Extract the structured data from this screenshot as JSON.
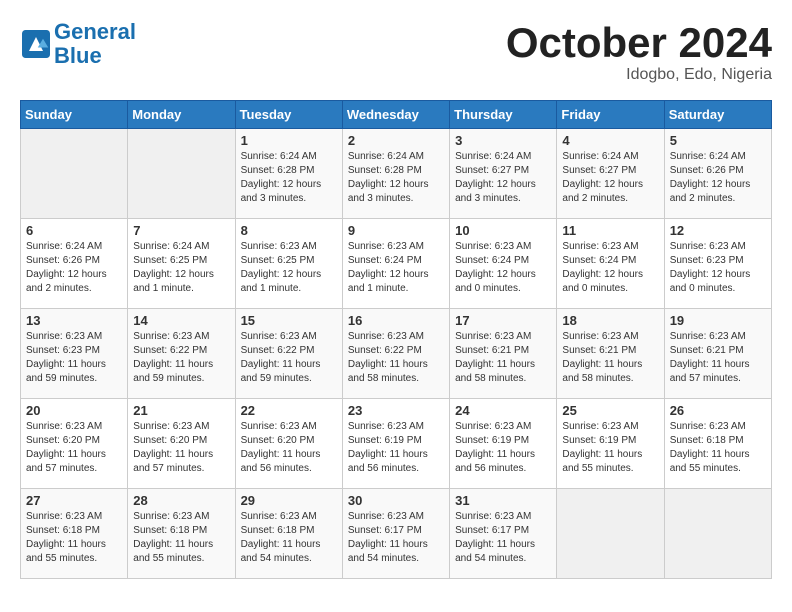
{
  "header": {
    "logo_line1": "General",
    "logo_line2": "Blue",
    "month": "October 2024",
    "location": "Idogbo, Edo, Nigeria"
  },
  "weekdays": [
    "Sunday",
    "Monday",
    "Tuesday",
    "Wednesday",
    "Thursday",
    "Friday",
    "Saturday"
  ],
  "weeks": [
    [
      {
        "day": "",
        "info": ""
      },
      {
        "day": "",
        "info": ""
      },
      {
        "day": "1",
        "info": "Sunrise: 6:24 AM\nSunset: 6:28 PM\nDaylight: 12 hours\nand 3 minutes."
      },
      {
        "day": "2",
        "info": "Sunrise: 6:24 AM\nSunset: 6:28 PM\nDaylight: 12 hours\nand 3 minutes."
      },
      {
        "day": "3",
        "info": "Sunrise: 6:24 AM\nSunset: 6:27 PM\nDaylight: 12 hours\nand 3 minutes."
      },
      {
        "day": "4",
        "info": "Sunrise: 6:24 AM\nSunset: 6:27 PM\nDaylight: 12 hours\nand 2 minutes."
      },
      {
        "day": "5",
        "info": "Sunrise: 6:24 AM\nSunset: 6:26 PM\nDaylight: 12 hours\nand 2 minutes."
      }
    ],
    [
      {
        "day": "6",
        "info": "Sunrise: 6:24 AM\nSunset: 6:26 PM\nDaylight: 12 hours\nand 2 minutes."
      },
      {
        "day": "7",
        "info": "Sunrise: 6:24 AM\nSunset: 6:25 PM\nDaylight: 12 hours\nand 1 minute."
      },
      {
        "day": "8",
        "info": "Sunrise: 6:23 AM\nSunset: 6:25 PM\nDaylight: 12 hours\nand 1 minute."
      },
      {
        "day": "9",
        "info": "Sunrise: 6:23 AM\nSunset: 6:24 PM\nDaylight: 12 hours\nand 1 minute."
      },
      {
        "day": "10",
        "info": "Sunrise: 6:23 AM\nSunset: 6:24 PM\nDaylight: 12 hours\nand 0 minutes."
      },
      {
        "day": "11",
        "info": "Sunrise: 6:23 AM\nSunset: 6:24 PM\nDaylight: 12 hours\nand 0 minutes."
      },
      {
        "day": "12",
        "info": "Sunrise: 6:23 AM\nSunset: 6:23 PM\nDaylight: 12 hours\nand 0 minutes."
      }
    ],
    [
      {
        "day": "13",
        "info": "Sunrise: 6:23 AM\nSunset: 6:23 PM\nDaylight: 11 hours\nand 59 minutes."
      },
      {
        "day": "14",
        "info": "Sunrise: 6:23 AM\nSunset: 6:22 PM\nDaylight: 11 hours\nand 59 minutes."
      },
      {
        "day": "15",
        "info": "Sunrise: 6:23 AM\nSunset: 6:22 PM\nDaylight: 11 hours\nand 59 minutes."
      },
      {
        "day": "16",
        "info": "Sunrise: 6:23 AM\nSunset: 6:22 PM\nDaylight: 11 hours\nand 58 minutes."
      },
      {
        "day": "17",
        "info": "Sunrise: 6:23 AM\nSunset: 6:21 PM\nDaylight: 11 hours\nand 58 minutes."
      },
      {
        "day": "18",
        "info": "Sunrise: 6:23 AM\nSunset: 6:21 PM\nDaylight: 11 hours\nand 58 minutes."
      },
      {
        "day": "19",
        "info": "Sunrise: 6:23 AM\nSunset: 6:21 PM\nDaylight: 11 hours\nand 57 minutes."
      }
    ],
    [
      {
        "day": "20",
        "info": "Sunrise: 6:23 AM\nSunset: 6:20 PM\nDaylight: 11 hours\nand 57 minutes."
      },
      {
        "day": "21",
        "info": "Sunrise: 6:23 AM\nSunset: 6:20 PM\nDaylight: 11 hours\nand 57 minutes."
      },
      {
        "day": "22",
        "info": "Sunrise: 6:23 AM\nSunset: 6:20 PM\nDaylight: 11 hours\nand 56 minutes."
      },
      {
        "day": "23",
        "info": "Sunrise: 6:23 AM\nSunset: 6:19 PM\nDaylight: 11 hours\nand 56 minutes."
      },
      {
        "day": "24",
        "info": "Sunrise: 6:23 AM\nSunset: 6:19 PM\nDaylight: 11 hours\nand 56 minutes."
      },
      {
        "day": "25",
        "info": "Sunrise: 6:23 AM\nSunset: 6:19 PM\nDaylight: 11 hours\nand 55 minutes."
      },
      {
        "day": "26",
        "info": "Sunrise: 6:23 AM\nSunset: 6:18 PM\nDaylight: 11 hours\nand 55 minutes."
      }
    ],
    [
      {
        "day": "27",
        "info": "Sunrise: 6:23 AM\nSunset: 6:18 PM\nDaylight: 11 hours\nand 55 minutes."
      },
      {
        "day": "28",
        "info": "Sunrise: 6:23 AM\nSunset: 6:18 PM\nDaylight: 11 hours\nand 55 minutes."
      },
      {
        "day": "29",
        "info": "Sunrise: 6:23 AM\nSunset: 6:18 PM\nDaylight: 11 hours\nand 54 minutes."
      },
      {
        "day": "30",
        "info": "Sunrise: 6:23 AM\nSunset: 6:17 PM\nDaylight: 11 hours\nand 54 minutes."
      },
      {
        "day": "31",
        "info": "Sunrise: 6:23 AM\nSunset: 6:17 PM\nDaylight: 11 hours\nand 54 minutes."
      },
      {
        "day": "",
        "info": ""
      },
      {
        "day": "",
        "info": ""
      }
    ]
  ]
}
